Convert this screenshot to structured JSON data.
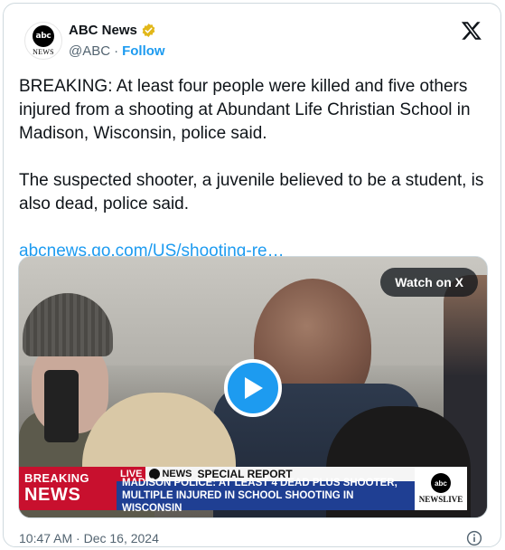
{
  "author": {
    "avatar_disc": "abc",
    "avatar_word": "NEWS",
    "display_name": "ABC News",
    "handle": "@ABC",
    "separator": "·",
    "follow_label": "Follow",
    "verified_color": "#e2b719"
  },
  "tweet": {
    "paragraph1": "BREAKING: At least four people were killed and five others injured from a shooting at Abundant Life Christian School in Madison, Wisconsin, police said.",
    "paragraph2": "The suspected shooter, a juvenile believed to be a student, is also dead, police said.",
    "link": "abcnews.go.com/US/shooting-re…"
  },
  "media": {
    "watch_label": "Watch on X",
    "banner": {
      "breaking_line1": "BREAKING",
      "breaking_line2": "NEWS",
      "live": "LIVE",
      "network": "NEWS",
      "report": "SPECIAL REPORT",
      "headline_line1": "MADISON POLICE: AT LEAST 4 DEAD PLUS SHOOTER,",
      "headline_line2": "MULTIPLE INJURED IN SCHOOL SHOOTING IN WISCONSIN",
      "corner_disc": "abc",
      "corner_text": "NEWSLIVE"
    }
  },
  "footer": {
    "timestamp": "10:47 AM · Dec 16, 2024"
  },
  "icons": {
    "x_logo": "x-logo-icon",
    "verified": "verified-badge-icon",
    "play": "play-icon",
    "info": "info-icon"
  },
  "colors": {
    "accent": "#1d9bf0",
    "text": "#0f1419",
    "muted": "#536471",
    "breaking_red": "#c8102e",
    "banner_blue": "#1f3f93"
  }
}
